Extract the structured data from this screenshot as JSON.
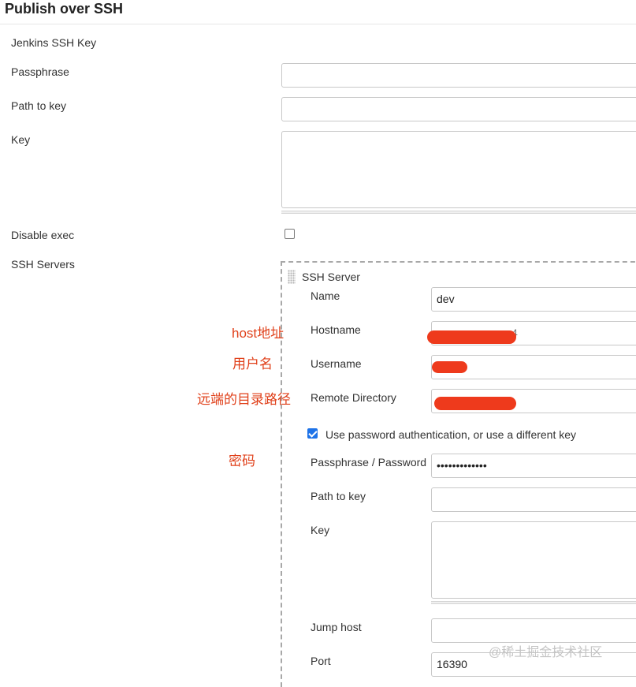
{
  "section_title": "Publish over SSH",
  "global": {
    "jenkins_ssh_key_label": "Jenkins SSH Key",
    "passphrase_label": "Passphrase",
    "passphrase_value": "",
    "path_to_key_label": "Path to key",
    "path_to_key_value": "",
    "key_label": "Key",
    "key_value": "",
    "disable_exec_label": "Disable exec",
    "disable_exec_checked": false,
    "ssh_servers_label": "SSH Servers"
  },
  "server": {
    "header": "SSH Server",
    "name_label": "Name",
    "name_value": "dev",
    "hostname_label": "Hostname",
    "hostname_visible_suffix": "4",
    "username_label": "Username",
    "remote_directory_label": "Remote Directory",
    "use_password_label": "Use password authentication, or use a different key",
    "use_password_checked": true,
    "passphrase_password_label": "Passphrase / Password",
    "passphrase_password_value": "•••••••••••••",
    "path_to_key_label": "Path to key",
    "path_to_key_value": "",
    "key_label": "Key",
    "key_value": "",
    "jump_host_label": "Jump host",
    "jump_host_value": "",
    "port_label": "Port",
    "port_value": "16390"
  },
  "annotations": {
    "host": "host地址",
    "user": "用户名",
    "remote_dir": "远端的目录路径",
    "password": "密码"
  },
  "watermark": "@稀土掘金技术社区",
  "colors": {
    "annotation": "#e0401a",
    "redaction": "#ee3a1c",
    "checkbox_checked": "#1e73e8"
  }
}
